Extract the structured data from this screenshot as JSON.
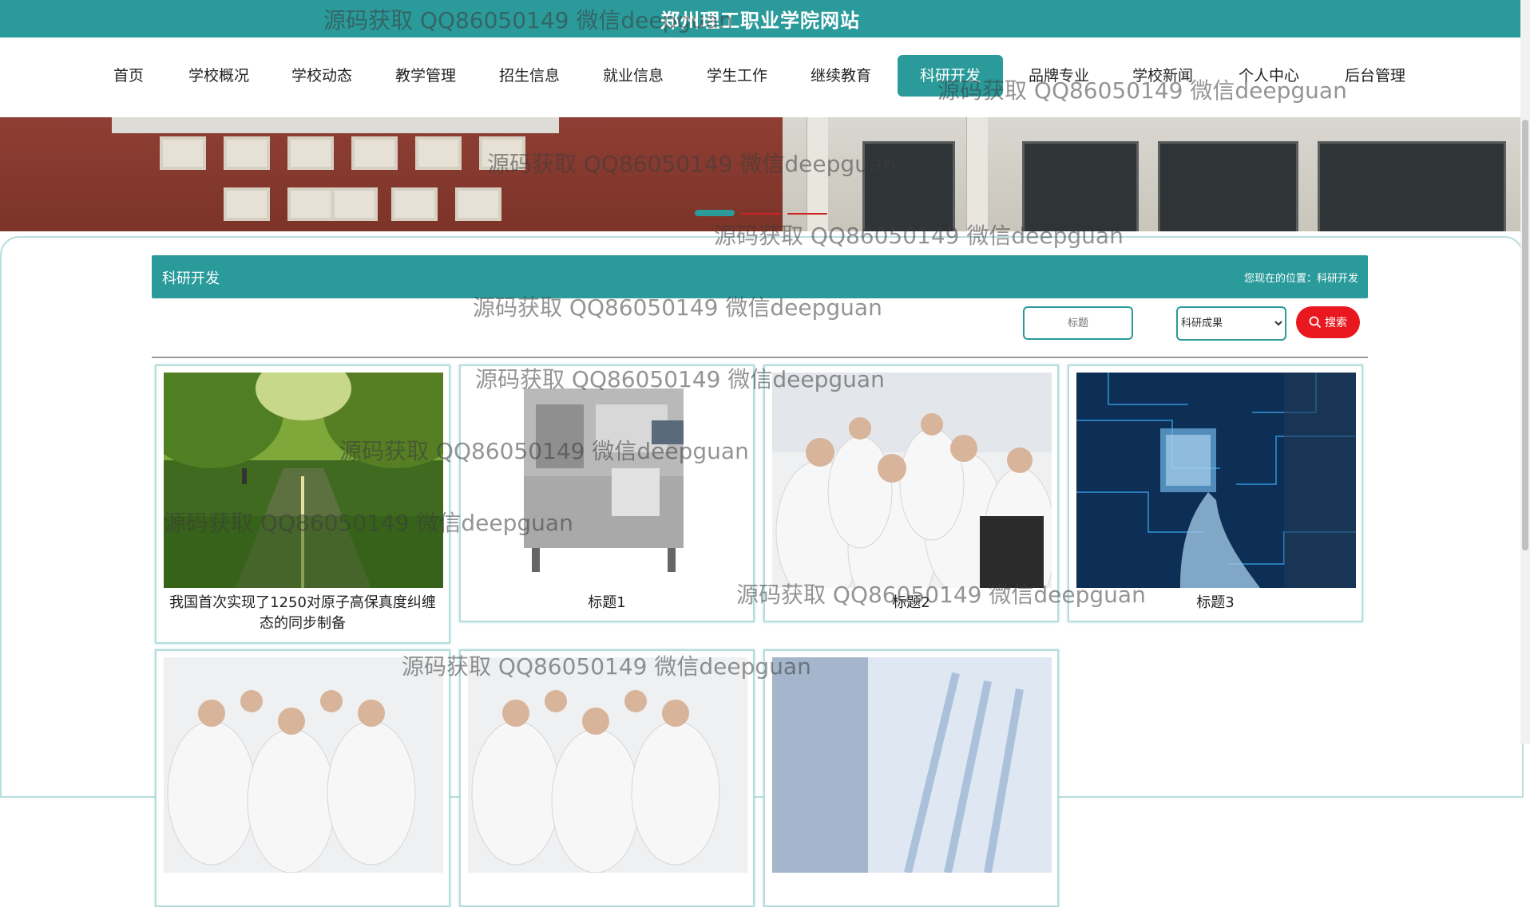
{
  "site": {
    "title": "郑州理工职业学院网站"
  },
  "nav": {
    "items": [
      "首页",
      "学校概况",
      "学校动态",
      "教学管理",
      "招生信息",
      "就业信息",
      "学生工作",
      "继续教育",
      "科研开发",
      "品牌专业",
      "学校新闻",
      "个人中心",
      "后台管理"
    ],
    "active": "科研开发"
  },
  "section": {
    "title": "科研开发",
    "breadcrumb": "您现在的位置：科研开发"
  },
  "search": {
    "placeholder": "标题",
    "select_value": "科研成果",
    "button_label": "搜索"
  },
  "cards": [
    {
      "title": "我国首次实现了1250对原子高保真度纠缠态的同步制备"
    },
    {
      "title": "标题1"
    },
    {
      "title": "标题2"
    },
    {
      "title": "标题3"
    },
    {
      "title": ""
    },
    {
      "title": ""
    },
    {
      "title": ""
    }
  ],
  "watermark": "源码获取 QQ86050149 微信deepguan",
  "colors": {
    "accent": "#2a9a9a",
    "search_button": "#e8181e"
  }
}
